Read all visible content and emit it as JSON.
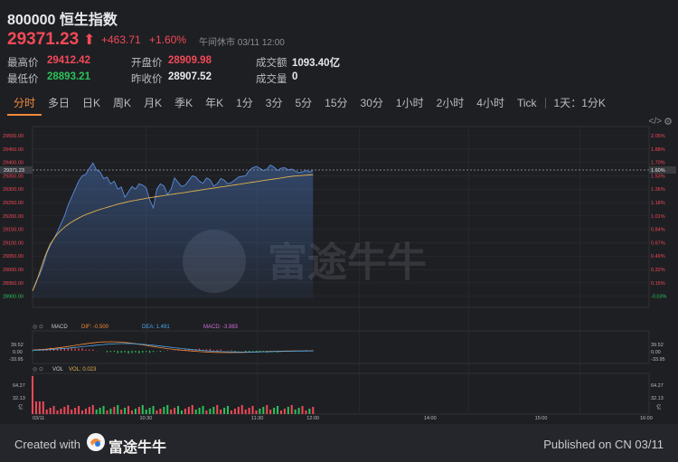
{
  "header": {
    "title": "800000 恒生指数",
    "price": "29371.23",
    "change": "+463.71",
    "change_pct": "+1.60%",
    "status": "午间休市 03/11 12:00"
  },
  "stats": {
    "high_label": "最高价",
    "high": "29412.42",
    "low_label": "最低价",
    "low": "28893.21",
    "open_label": "开盘价",
    "open": "28909.98",
    "prev_label": "昨收价",
    "prev": "28907.52",
    "turnover_label": "成交额",
    "turnover": "1093.40亿",
    "volume_label": "成交量",
    "volume": "0"
  },
  "tabs": [
    "分时",
    "多日",
    "日K",
    "周K",
    "月K",
    "季K",
    "年K",
    "1分",
    "3分",
    "5分",
    "15分",
    "30分",
    "1小时",
    "2小时",
    "4小时",
    "Tick",
    "1天：1分K"
  ],
  "active_tab": "分时",
  "colors": {
    "up": "#f24957",
    "down": "#2cc25b",
    "accent": "#f28a3a",
    "line": "#5b8bd8",
    "avg": "#e2b04a"
  },
  "icons": {
    "expand": "expand-icon",
    "settings": "gear-icon"
  },
  "chart_data": {
    "type": "line",
    "y_ticks_left": [
      "29500.00",
      "29450.00",
      "29400.00",
      "29350.00",
      "29300.00",
      "29250.00",
      "29200.00",
      "29150.00",
      "29100.00",
      "29050.00",
      "29000.00",
      "28950.00",
      "28900.00"
    ],
    "y_ticks_right": [
      "2.05%",
      "1.88%",
      "1.70%",
      "1.53%",
      "1.36%",
      "1.18%",
      "1.01%",
      "0.84%",
      "0.67%",
      "0.49%",
      "0.32%",
      "0.15%",
      "-0.03%"
    ],
    "current_price_label": "29371.23",
    "current_pct_label": "1.60%",
    "x_ticks": [
      "03/11",
      "10:30",
      "11:30",
      "12:00",
      "14:00",
      "15:00",
      "16:00"
    ],
    "ylim": [
      28892,
      29500
    ],
    "price_series": [
      28920,
      28955,
      28980,
      29015,
      29060,
      29090,
      29115,
      29140,
      29170,
      29200,
      29240,
      29270,
      29300,
      29330,
      29350,
      29355,
      29378,
      29398,
      29372,
      29365,
      29340,
      29345,
      29320,
      29330,
      29300,
      29308,
      29270,
      29290,
      29310,
      29300,
      29320,
      29315,
      29305,
      29260,
      29230,
      29300,
      29320,
      29312,
      29280,
      29300,
      29342,
      29325,
      29310,
      29315,
      29332,
      29350,
      29345,
      29330,
      29322,
      29342,
      29335,
      29312,
      29320,
      29340,
      29333,
      29320,
      29325,
      29335,
      29345,
      29348,
      29350,
      29370,
      29380,
      29385,
      29378,
      29370,
      29375,
      29390,
      29382,
      29370,
      29378,
      29380,
      29372,
      29375,
      29368,
      29362,
      29365,
      29370,
      29364,
      29371
    ],
    "avg_series": [
      28920,
      28950,
      28990,
      29030,
      29065,
      29095,
      29115,
      29132,
      29146,
      29158,
      29168,
      29177,
      29185,
      29192,
      29199,
      29205,
      29210,
      29215,
      29220,
      29224,
      29228,
      29232,
      29236,
      29240,
      29244,
      29247,
      29250,
      29253,
      29256,
      29258,
      29261,
      29263,
      29266,
      29268,
      29270,
      29272,
      29274,
      29276,
      29278,
      29280,
      29282,
      29284,
      29286,
      29288,
      29290,
      29292,
      29294,
      29296,
      29298,
      29300,
      29302,
      29304,
      29306,
      29308,
      29310,
      29312,
      29314,
      29316,
      29318,
      29320,
      29322,
      29324,
      29326,
      29328,
      29330,
      29332,
      29334,
      29336,
      29338,
      29340,
      29342,
      29344,
      29346,
      29348,
      29349,
      29350,
      29351,
      29352,
      29353,
      29354
    ],
    "macd": {
      "legend": "MACD",
      "dif": "DIF: -0.500",
      "dea": "DEA: 1.491",
      "macd": "MACD: -3.983",
      "ticks": [
        "39.52",
        "0.00",
        "-33.95"
      ]
    },
    "vol": {
      "legend": "VOL",
      "vol": "VOL: 0.023",
      "ticks": [
        "64.27",
        "32.13",
        "亿"
      ]
    }
  },
  "watermark": "富途牛牛",
  "footer": {
    "created": "Created with",
    "brand": "富途牛牛",
    "published": "Published on CN 03/11"
  }
}
